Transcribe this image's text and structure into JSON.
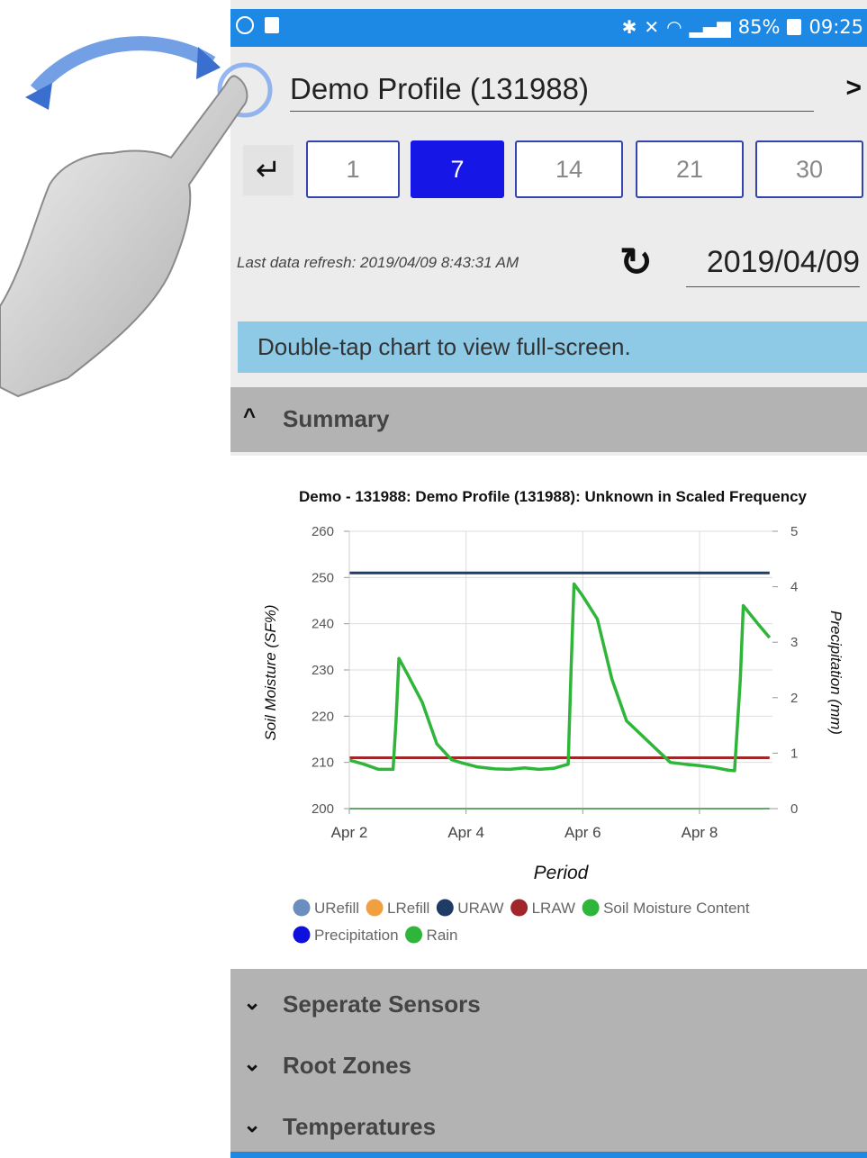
{
  "status_bar": {
    "battery": "85%",
    "time": "09:25",
    "icons": [
      "whatsapp-icon",
      "image-icon",
      "bluetooth-icon",
      "mute-icon",
      "wifi-icon",
      "signal-icon",
      "battery-icon"
    ]
  },
  "header": {
    "profile_name": "Demo Profile (131988)",
    "next_icon": "chevron-right-icon"
  },
  "period": {
    "back_icon": "return-arrow-icon",
    "buttons": [
      "1",
      "7",
      "14",
      "21",
      "30"
    ],
    "selected": "7"
  },
  "refresh": {
    "last_refresh": "Last data refresh: 2019/04/09 8:43:31 AM",
    "refresh_icon": "refresh-icon",
    "date": "2019/04/09"
  },
  "hint": "Double-tap chart to view full-screen.",
  "sections": {
    "summary": "Summary",
    "separate_sensors": "Seperate Sensors",
    "root_zones": "Root Zones",
    "temperatures": "Temperatures"
  },
  "colors": {
    "accent": "#1e88e5",
    "selected_button": "#1616e6",
    "hint_bg": "#8ec9e6",
    "section_bg": "#b3b3b3"
  },
  "chart_data": {
    "type": "line",
    "title": "Demo - 131988: Demo Profile (131988): Unknown in Scaled Frequency",
    "xlabel": "Period",
    "ylabel": "Soil Moisture (SF%)",
    "y2label": "Precipitation (mm)",
    "ylim": [
      200,
      260
    ],
    "y2lim": [
      0,
      5
    ],
    "yticks": [
      "200",
      "210",
      "220",
      "230",
      "240",
      "250",
      "260"
    ],
    "y2ticks": [
      "0",
      "1",
      "2",
      "3",
      "4",
      "5"
    ],
    "xlim": [
      2,
      9.25
    ],
    "xticks": [
      {
        "x": 2,
        "label": "Apr 2"
      },
      {
        "x": 4,
        "label": "Apr 4"
      },
      {
        "x": 6,
        "label": "Apr 6"
      },
      {
        "x": 8,
        "label": "Apr 8"
      }
    ],
    "grid": true,
    "legend_position": "bottom",
    "legend": [
      {
        "name": "URefill",
        "color": "#6c8ebf"
      },
      {
        "name": "LRefill",
        "color": "#f0a040"
      },
      {
        "name": "URAW",
        "color": "#1f3b66"
      },
      {
        "name": "LRAW",
        "color": "#a0262a"
      },
      {
        "name": "Soil Moisture Content",
        "color": "#2fb539"
      },
      {
        "name": "Precipitation",
        "color": "#1010dd"
      },
      {
        "name": "Rain",
        "color": "#2fb539"
      }
    ],
    "series": [
      {
        "name": "URAW",
        "axis": "left",
        "color": "#1f3b66",
        "x": [
          2,
          9.2
        ],
        "y": [
          251,
          251
        ]
      },
      {
        "name": "LRAW",
        "axis": "left",
        "color": "#a0262a",
        "x": [
          2,
          9.2
        ],
        "y": [
          211,
          211
        ]
      },
      {
        "name": "Soil Moisture Content",
        "axis": "left",
        "color": "#2fb539",
        "x": [
          2,
          2.25,
          2.5,
          2.75,
          2.8,
          2.85,
          3.0,
          3.25,
          3.5,
          3.75,
          3.9,
          4.2,
          4.5,
          4.75,
          5.0,
          5.25,
          5.5,
          5.75,
          5.8,
          5.85,
          6.0,
          6.25,
          6.5,
          6.75,
          7.0,
          7.25,
          7.5,
          7.75,
          8.0,
          8.25,
          8.5,
          8.6,
          8.7,
          8.75,
          9.0,
          9.2
        ],
        "y": [
          210.5,
          209.6,
          208.5,
          208.5,
          219,
          232.5,
          229,
          223,
          214,
          210.6,
          210,
          209,
          208.6,
          208.5,
          208.8,
          208.5,
          208.7,
          209.6,
          230,
          248.6,
          246,
          241,
          228,
          219,
          216,
          213,
          210,
          209.6,
          209.3,
          208.9,
          208.3,
          208.2,
          228,
          243.9,
          240,
          237
        ]
      },
      {
        "name": "Rain",
        "axis": "right",
        "color": "#2fb539",
        "x": [
          2,
          9.2
        ],
        "y": [
          0,
          0
        ]
      }
    ]
  }
}
